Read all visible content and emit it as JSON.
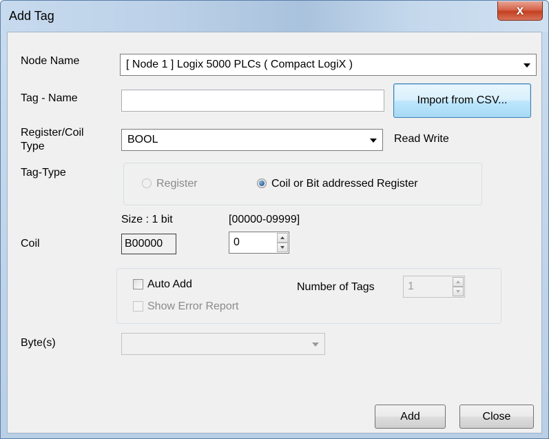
{
  "window": {
    "title": "Add Tag",
    "close_glyph": "x"
  },
  "node": {
    "label": "Node Name",
    "value": "[ Node 1 ] Logix 5000 PLCs ( Compact LogiX )"
  },
  "tag_name": {
    "label": "Tag - Name",
    "value": "",
    "import_button": "Import from CSV..."
  },
  "register_type": {
    "label_line1": "Register/Coil",
    "label_line2": "Type",
    "value": "BOOL",
    "access": "Read Write"
  },
  "tag_type": {
    "label": "Tag-Type",
    "option_register": "Register",
    "option_coil": "Coil or Bit addressed Register",
    "selected": "Coil or Bit addressed Register"
  },
  "coil": {
    "label": "Coil",
    "size_text": "Size : 1 bit",
    "range_text": "[00000-09999]",
    "address": "B00000",
    "value": "0"
  },
  "auto_add": {
    "auto_add_label": "Auto Add",
    "auto_add_checked": false,
    "show_error_label": "Show Error Report",
    "show_error_checked": false,
    "number_of_tags_label": "Number of Tags",
    "number_of_tags_value": "1"
  },
  "bytes": {
    "label": "Byte(s)",
    "value": ""
  },
  "buttons": {
    "add": "Add",
    "close": "Close"
  },
  "colors": {
    "close_button": "#c4401f",
    "client_bg": "#f0f0f0",
    "title_bg": "#bcd1e8"
  }
}
